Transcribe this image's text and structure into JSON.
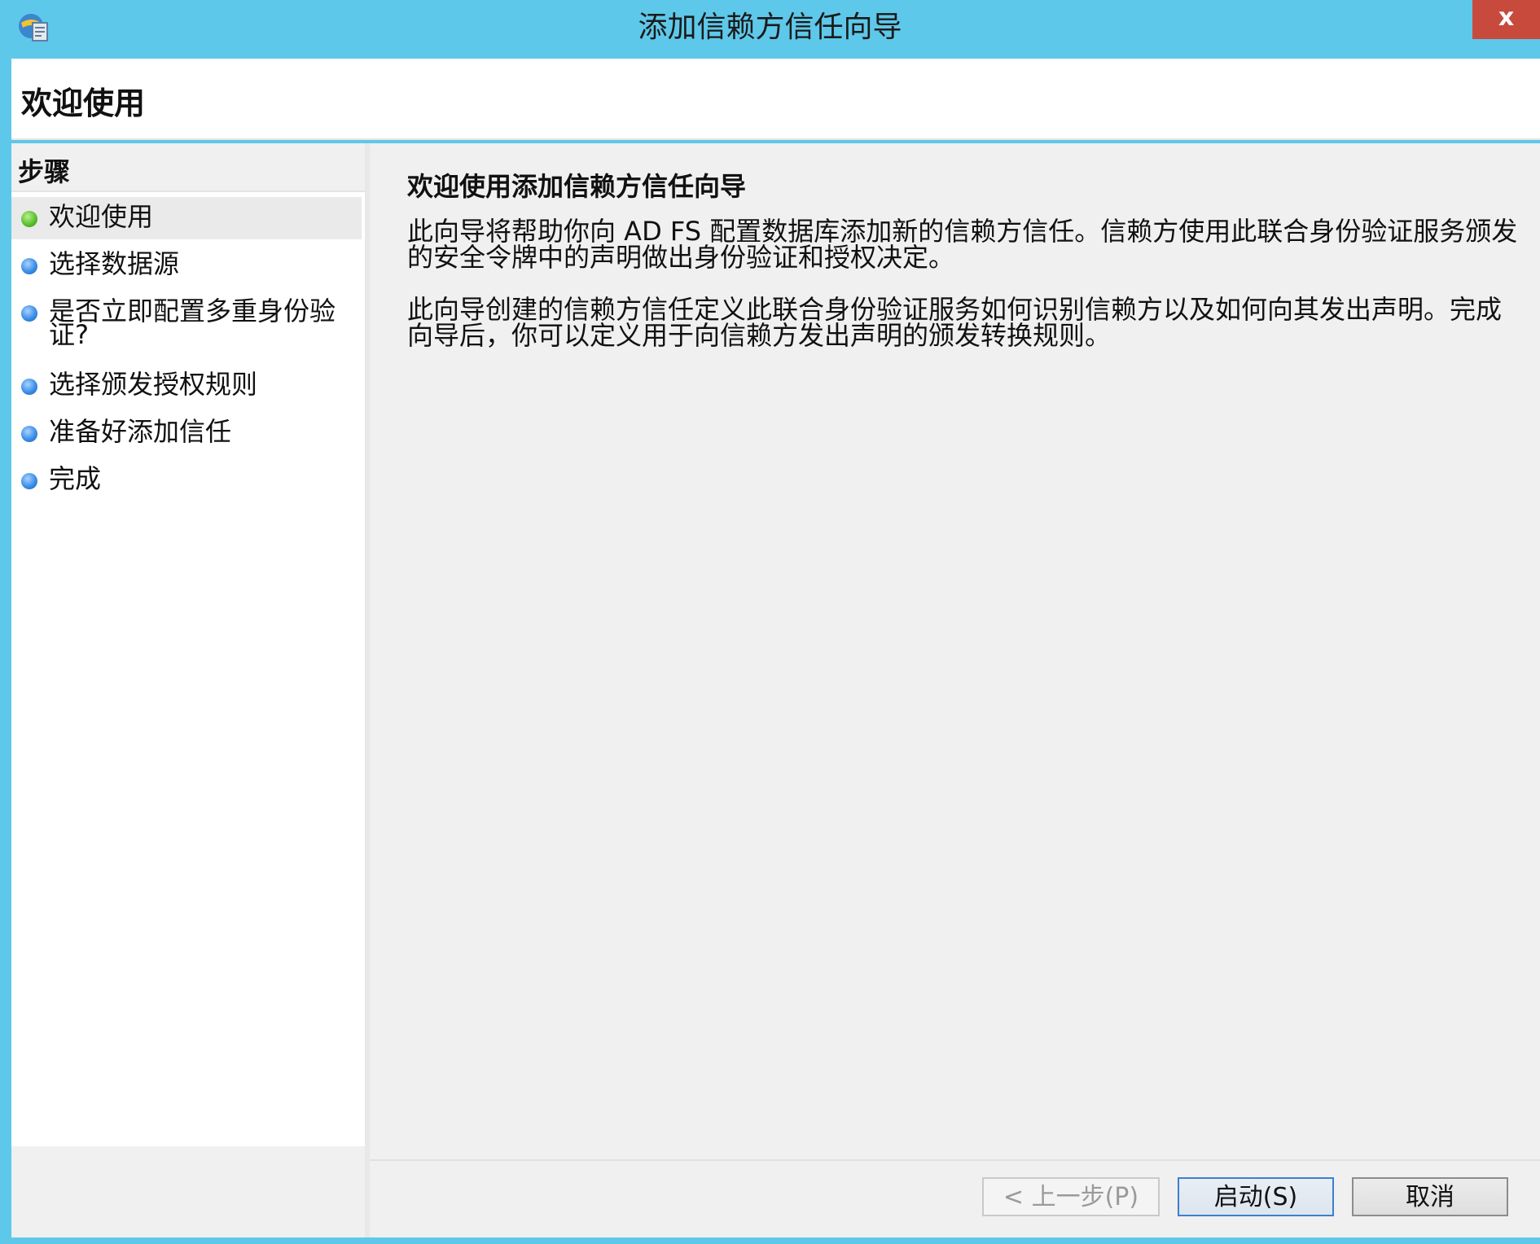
{
  "window": {
    "title": "添加信赖方信任向导",
    "close_label": "x"
  },
  "header": {
    "title": "欢迎使用"
  },
  "steps": {
    "heading": "步骤",
    "items": [
      {
        "label": "欢迎使用",
        "status": "current"
      },
      {
        "label": "选择数据源",
        "status": "pending"
      },
      {
        "label_line1": "是否立即配置多重身份验",
        "label_line2": "证?",
        "status": "pending"
      },
      {
        "label": "选择颁发授权规则",
        "status": "pending"
      },
      {
        "label": "准备好添加信任",
        "status": "pending"
      },
      {
        "label": "完成",
        "status": "pending"
      }
    ]
  },
  "content": {
    "title": "欢迎使用添加信赖方信任向导",
    "paragraph1_line1": "此向导将帮助你向 AD FS 配置数据库添加新的信赖方信任。信赖方使用此联合身份验证服务颁发",
    "paragraph1_line2": "的安全令牌中的声明做出身份验证和授权决定。",
    "paragraph2_line1": "此向导创建的信赖方信任定义此联合身份验证服务如何识别信赖方以及如何向其发出声明。完成",
    "paragraph2_line2": "向导后，你可以定义用于向信赖方发出声明的颁发转换规则。"
  },
  "buttons": {
    "back_label": "< 上一步(P)",
    "start_label": "启动(S)",
    "cancel_label": "取消"
  },
  "colors": {
    "titlebar": "#5ec8ea",
    "close": "#c74a3d",
    "step_current": "#5cc02f",
    "step_pending": "#3b8ee8"
  }
}
